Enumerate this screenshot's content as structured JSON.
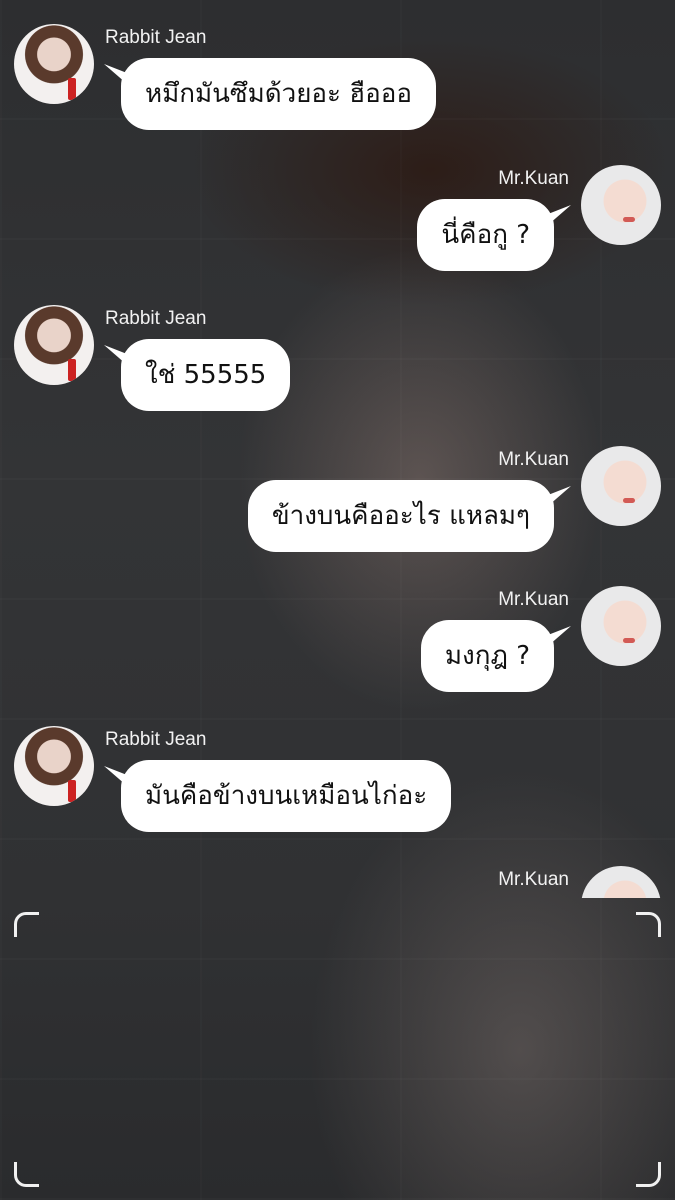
{
  "messages": [
    {
      "sender": "Rabbit Jean",
      "side": "left",
      "text": "หมึกมันซึมด้วยอะ ฮือออ"
    },
    {
      "sender": "Mr.Kuan",
      "side": "right",
      "text": "นี่คือกู ?"
    },
    {
      "sender": "Rabbit Jean",
      "side": "left",
      "text": "ใช่ 55555"
    },
    {
      "sender": "Mr.Kuan",
      "side": "right",
      "text": "ข้างบนคืออะไร แหลมๆ"
    },
    {
      "sender": "Mr.Kuan",
      "side": "right",
      "text": "มงกุฎ ?"
    },
    {
      "sender": "Rabbit Jean",
      "side": "left",
      "text": "มันคือข้างบนเหมือนไก่อะ"
    },
    {
      "sender": "Mr.Kuan",
      "side": "right",
      "text": ""
    }
  ]
}
